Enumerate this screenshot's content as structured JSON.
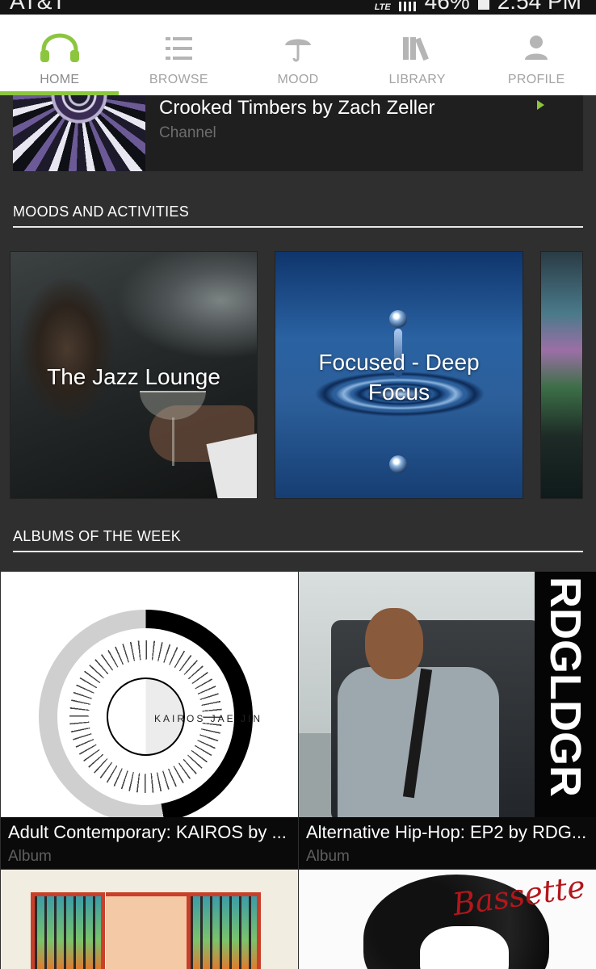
{
  "status_bar": {
    "carrier": "AT&T",
    "network": "LTE",
    "battery": "46%",
    "time": "2:54 PM"
  },
  "nav": {
    "tabs": [
      {
        "label": "HOME",
        "icon": "headphones-icon",
        "active": true
      },
      {
        "label": "BROWSE",
        "icon": "list-icon",
        "active": false
      },
      {
        "label": "MOOD",
        "icon": "umbrella-icon",
        "active": false
      },
      {
        "label": "LIBRARY",
        "icon": "books-icon",
        "active": false
      },
      {
        "label": "PROFILE",
        "icon": "person-icon",
        "active": false
      }
    ],
    "accent": "#8cc63f"
  },
  "channel": {
    "title": "Crooked Timbers by Zach Zeller",
    "subtitle": "Channel"
  },
  "moods": {
    "header": "MOODS AND ACTIVITIES",
    "items": [
      {
        "label": "The Jazz Lounge"
      },
      {
        "label": "Focused - Deep Focus"
      },
      {
        "label": ""
      }
    ]
  },
  "albums": {
    "header": "ALBUMS OF THE WEEK",
    "items": [
      {
        "title": "Adult Contemporary: KAIROS by ...",
        "type": "Album",
        "cover_text": "KAIROS JAE JIN"
      },
      {
        "title": "Alternative Hip-Hop: EP2 by RDG...",
        "type": "Album",
        "cover_text": "RDGLDGR"
      },
      {
        "title": "",
        "type": "",
        "cover_text": ""
      },
      {
        "title": "",
        "type": "",
        "cover_text": "Bassette"
      }
    ]
  }
}
